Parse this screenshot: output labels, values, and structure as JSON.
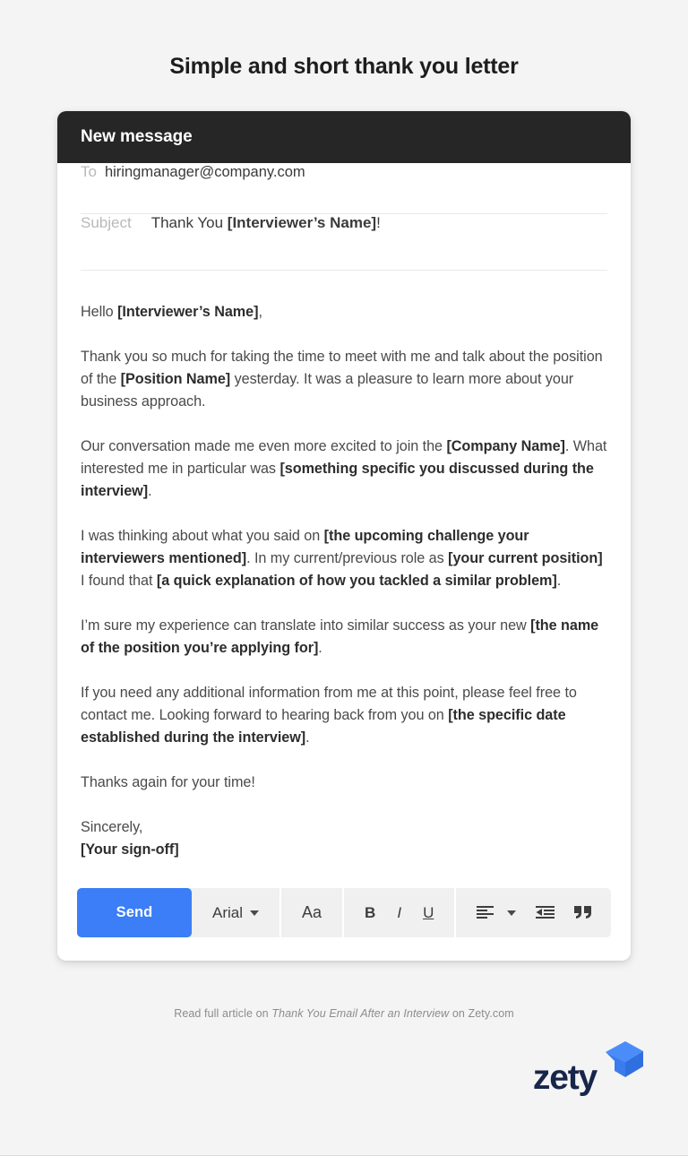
{
  "page": {
    "title": "Simple and short thank you letter",
    "background_color": "#f4f4f4"
  },
  "email_card": {
    "header": {
      "title": "New message",
      "background_color": "#262626"
    },
    "fields": {
      "to": {
        "label": "To",
        "value": "hiringmanager@company.com"
      },
      "subject": {
        "label": "Subject",
        "value_plain": "Thank You ",
        "value_placeholder": "[Interviewer’s Name]",
        "value_suffix": "!"
      }
    },
    "body": {
      "paragraphs": [
        {
          "parts": [
            {
              "text": "Hello ",
              "bold": false
            },
            {
              "text": "[Interviewer’s Name]",
              "bold": true
            },
            {
              "text": ",",
              "bold": false
            }
          ]
        },
        {
          "parts": [
            {
              "text": "Thank you so much for taking the time to meet with me and talk about the position of the ",
              "bold": false
            },
            {
              "text": "[Position Name]",
              "bold": true
            },
            {
              "text": " yesterday. It was a pleasure to learn more about your business approach.",
              "bold": false
            }
          ]
        },
        {
          "parts": [
            {
              "text": "Our conversation made me even more excited to join the ",
              "bold": false
            },
            {
              "text": "[Company Name]",
              "bold": true
            },
            {
              "text": ". What interested me in particular was ",
              "bold": false
            },
            {
              "text": "[something specific you discussed during the interview]",
              "bold": true
            },
            {
              "text": ".",
              "bold": false
            }
          ]
        },
        {
          "parts": [
            {
              "text": "I was thinking about what you said on ",
              "bold": false
            },
            {
              "text": "[the upcoming challenge your interviewers mentioned]",
              "bold": true
            },
            {
              "text": ". In my current/previous role as ",
              "bold": false
            },
            {
              "text": "[your current position]",
              "bold": true
            },
            {
              "text": " I found that ",
              "bold": false
            },
            {
              "text": "[a quick explanation of how you tackled a similar problem]",
              "bold": true
            },
            {
              "text": ".",
              "bold": false
            }
          ]
        },
        {
          "parts": [
            {
              "text": "I’m sure my experience can translate into similar success as your new ",
              "bold": false
            },
            {
              "text": "[the name of the position you’re applying for]",
              "bold": true
            },
            {
              "text": ".",
              "bold": false
            }
          ]
        },
        {
          "parts": [
            {
              "text": "If you need any additional information from me at this point, please feel free to contact me. Looking forward to hearing back from you on ",
              "bold": false
            },
            {
              "text": "[the specific date established during the interview]",
              "bold": true
            },
            {
              "text": ".",
              "bold": false
            }
          ]
        },
        {
          "parts": [
            {
              "text": "Thanks again for your time!",
              "bold": false
            }
          ]
        },
        {
          "parts": [
            {
              "text": "Sincerely,",
              "bold": false
            },
            {
              "text": "\n",
              "bold": false
            },
            {
              "text": "[Your sign-off]",
              "bold": true
            }
          ]
        }
      ]
    },
    "toolbar": {
      "send_label": "Send",
      "send_color": "#3b7ef7",
      "font_name": "Arial",
      "font_size_label": "Aa",
      "bold_label": "B",
      "italic_label": "I",
      "underline_label": "U",
      "icons": [
        "font-dropdown-caret-icon",
        "align-left-icon",
        "align-dropdown-caret-icon",
        "outdent-icon",
        "blockquote-icon"
      ]
    }
  },
  "footer": {
    "prefix": "Read full article on ",
    "article_title": "Thank You Email After an Interview",
    "suffix": " on Zety.com",
    "logo_text": "zety",
    "logo_color": "#17264a",
    "logo_mark_colors": [
      "#4b8df8",
      "#2f6fe0",
      "#1f5bc4"
    ]
  }
}
